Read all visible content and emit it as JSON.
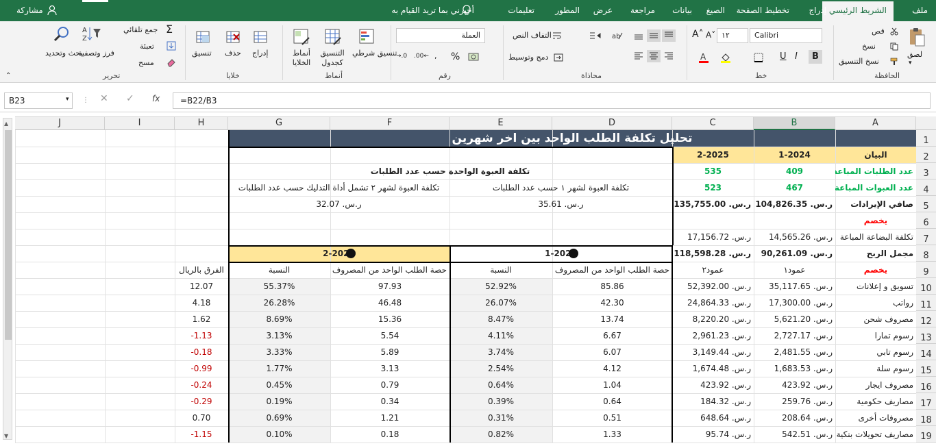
{
  "tabs": {
    "file": "ملف",
    "home": "الشريط الرئيسي",
    "insert": "إدراج",
    "layout": "تخطيط الصفحة",
    "formulas": "الصيغ",
    "data": "بيانات",
    "review": "مراجعة",
    "view": "عرض",
    "developer": "المطور",
    "help": "تعليمات",
    "tell": "أخبرني بما تريد القيام به",
    "share": "مشاركة"
  },
  "ribbon": {
    "clipboard": {
      "label": "الحافظة",
      "paste": "لصق",
      "cut": "قص",
      "copy": "نسخ",
      "format_painter": "نسخ التنسيق"
    },
    "font": {
      "label": "خط",
      "name": "Calibri",
      "size": "١٢",
      "bold": "B",
      "italic": "I",
      "underline": "U"
    },
    "alignment": {
      "label": "محاذاة",
      "wrap": "التفاف النص",
      "merge": "دمج وتوسيط"
    },
    "number": {
      "label": "رقم",
      "format": "العملة",
      "percent": "%"
    },
    "styles": {
      "label": "أنماط",
      "conditional": "تنسيق شرطي",
      "as_table": "التنسيق كجدول",
      "cell_styles": "أنماط الخلايا"
    },
    "cells": {
      "label": "خلايا",
      "insert": "إدراج",
      "delete": "حذف",
      "format": "تنسيق"
    },
    "editing": {
      "label": "تحرير",
      "autosum": "جمع تلقائي",
      "fill": "تعبئة",
      "clear": "مسح",
      "sort": "فرز وتصفية",
      "find": "بحث وتحديد"
    }
  },
  "formula_bar": {
    "name_box": "B23",
    "fx": "fx",
    "formula": "=B22/B3"
  },
  "columns": [
    "A",
    "B",
    "C",
    "D",
    "E",
    "F",
    "G",
    "H",
    "I",
    "J"
  ],
  "rows": [
    "1",
    "2",
    "3",
    "4",
    "5",
    "6",
    "7",
    "8",
    "9",
    "10",
    "11",
    "12",
    "13",
    "14",
    "15",
    "16",
    "17",
    "18",
    "19"
  ],
  "title": "تحليل تكلفة الطلب الواحد بين اخر شهرين",
  "header_row": {
    "label": "البيان",
    "b": "1-2024",
    "c": "2-2025"
  },
  "left_rows": [
    {
      "a": "عدد الطلبات المباعة",
      "b": "409",
      "c": "535"
    },
    {
      "a": "عدد العبوات المباعة",
      "b": "467",
      "c": "523"
    },
    {
      "a": "صافي الإيرادات",
      "b": "ر.س. 104,826.35",
      "c": "ر.س. 135,755.00"
    },
    {
      "a": "يخصم",
      "b": "",
      "c": ""
    },
    {
      "a": "تكلفة البضاعة المباعة",
      "b": "ر.س. 14,565.26",
      "c": "ر.س. 17,156.72"
    },
    {
      "a": "مجمل الربح",
      "b": "ر.س. 90,261.09",
      "c": "ر.س. 118,598.28"
    },
    {
      "a": "يخصم",
      "b": "عمود١",
      "c": "عمود٢"
    },
    {
      "a": "تسويق و إعلانات",
      "b": "ر.س. 35,117.65",
      "c": "ر.س. 52,392.00"
    },
    {
      "a": "رواتب",
      "b": "ر.س. 17,300.00",
      "c": "ر.س. 24,864.33"
    },
    {
      "a": "مصروف شحن",
      "b": "ر.س. 5,621.20",
      "c": "ر.س. 8,220.20"
    },
    {
      "a": "رسوم تمارا",
      "b": "ر.س. 2,727.17",
      "c": "ر.س. 2,961.23"
    },
    {
      "a": "رسوم تابي",
      "b": "ر.س. 2,481.55",
      "c": "ر.س. 3,149.44"
    },
    {
      "a": "رسوم سلة",
      "b": "ر.س. 1,683.53",
      "c": "ر.س. 1,674.48"
    },
    {
      "a": "مصروف ايجار",
      "b": "ر.س. 423.92",
      "c": "ر.س. 423.92"
    },
    {
      "a": "مصاريف حكومية",
      "b": "ر.س. 259.76",
      "c": "ر.س. 184.32"
    },
    {
      "a": "مصروفات أخرى",
      "b": "ر.س. 208.64",
      "c": "ر.س. 648.64"
    },
    {
      "a": "مصاريف تحويلات بنكية",
      "b": "ر.س. 542.51",
      "c": "ر.س. 95.74"
    }
  ],
  "cost_box": {
    "header": "تكلفة العبوة الواحدة حسب عدد الطلبات",
    "m1_label": "تكلفة العبوة لشهر ١ حسب عدد الطلبات",
    "m2_label": "تكلفة العبوة لشهر ٢ تشمل أداة التدليك حسب عدد الطلبات",
    "m1_value": "ر.س. 35.61",
    "m2_value": "ر.س. 32.07"
  },
  "share_box": {
    "p1": "1-2024",
    "p2": "2-2025",
    "col_share": "حصة الطلب الواحد من المصروف",
    "col_pct": "النسبة",
    "col_diff": "الفرق بالريال",
    "rows": [
      {
        "d": "85.86",
        "e": "52.92%",
        "f": "97.93",
        "g": "55.37%",
        "h": "12.07"
      },
      {
        "d": "42.30",
        "e": "26.07%",
        "f": "46.48",
        "g": "26.28%",
        "h": "4.18"
      },
      {
        "d": "13.74",
        "e": "8.47%",
        "f": "15.36",
        "g": "8.69%",
        "h": "1.62"
      },
      {
        "d": "6.67",
        "e": "4.11%",
        "f": "5.54",
        "g": "3.13%",
        "h": "-1.13"
      },
      {
        "d": "6.07",
        "e": "3.74%",
        "f": "5.89",
        "g": "3.33%",
        "h": "-0.18"
      },
      {
        "d": "4.12",
        "e": "2.54%",
        "f": "3.13",
        "g": "1.77%",
        "h": "-0.99"
      },
      {
        "d": "1.04",
        "e": "0.64%",
        "f": "0.79",
        "g": "0.45%",
        "h": "-0.24"
      },
      {
        "d": "0.64",
        "e": "0.39%",
        "f": "0.34",
        "g": "0.19%",
        "h": "-0.29"
      },
      {
        "d": "0.51",
        "e": "0.31%",
        "f": "1.21",
        "g": "0.69%",
        "h": "0.70"
      },
      {
        "d": "1.33",
        "e": "0.82%",
        "f": "0.18",
        "g": "0.10%",
        "h": "-1.15"
      }
    ]
  },
  "colors": {
    "accent": "#217346",
    "title_bg": "#44546a",
    "header_bg": "#ffe699",
    "green": "#00b050",
    "red": "#ff0000",
    "neg": "#c00000",
    "shade": "#f2f2f2"
  }
}
